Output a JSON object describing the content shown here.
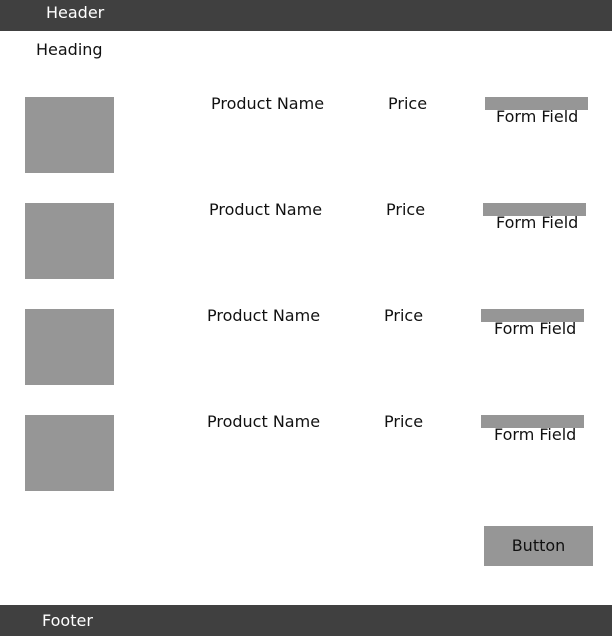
{
  "header": {
    "title": "Header"
  },
  "page": {
    "heading": "Heading"
  },
  "products": [
    {
      "name": "Product Name",
      "price": "Price",
      "field_label": "Form Field"
    },
    {
      "name": "Product Name",
      "price": "Price",
      "field_label": "Form Field"
    },
    {
      "name": "Product Name",
      "price": "Price",
      "field_label": "Form Field"
    },
    {
      "name": "Product Name",
      "price": "Price",
      "field_label": "Form Field"
    }
  ],
  "actions": {
    "button_label": "Button"
  },
  "footer": {
    "title": "Footer"
  },
  "colors": {
    "bar": "#404040",
    "placeholder": "#969696",
    "background": "#ffffff"
  }
}
